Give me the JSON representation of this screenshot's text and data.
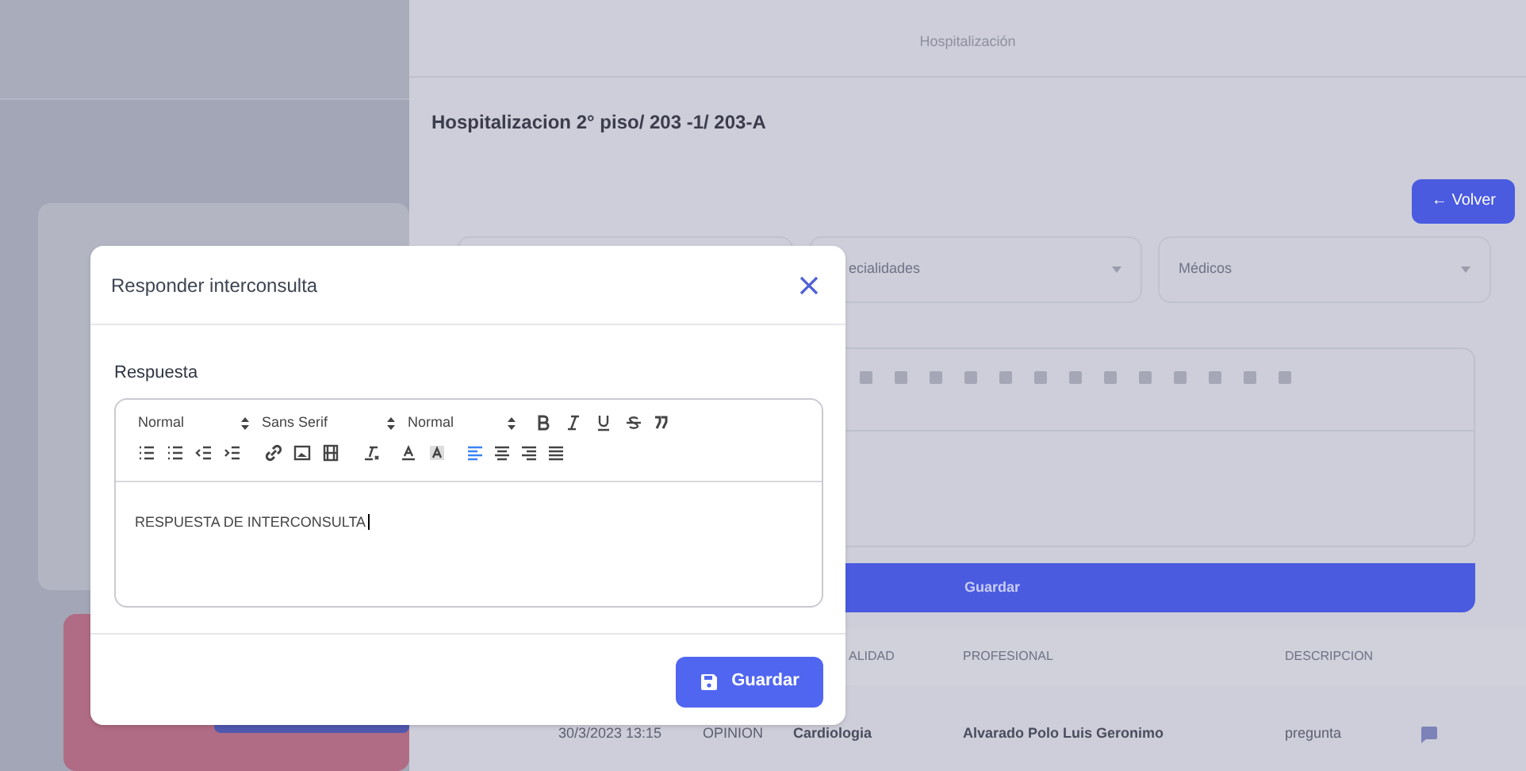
{
  "page": {
    "subtitle": "Hospitalización",
    "location": "Hospitalizacion 2° piso/ 203 -1/ 203-A",
    "back_button": "← Volver",
    "filters": [
      {
        "placeholder": "ecialidades"
      },
      {
        "placeholder": "Médicos"
      }
    ],
    "save_bar": "Guardar",
    "table": {
      "columns": [
        "",
        "",
        "ALIDAD",
        "PROFESIONAL",
        "DESCRIPCION"
      ],
      "rows": [
        {
          "cells": [
            "30/3/2023 13:15",
            "OPINION",
            "Cardiologia",
            "Alvarado Polo Luis Geronimo",
            "pregunta"
          ]
        }
      ]
    }
  },
  "modal": {
    "title": "Responder interconsulta",
    "field_label": "Respuesta",
    "pickers": [
      "Normal",
      "Sans Serif",
      "Normal"
    ],
    "align_buttons": [
      {
        "selected": true
      },
      {
        "selected": false
      },
      {
        "selected": false
      },
      {
        "selected": false
      }
    ],
    "value": "RESPUESTA DE INTERCONSULTA",
    "save_button": "Guardar"
  }
}
